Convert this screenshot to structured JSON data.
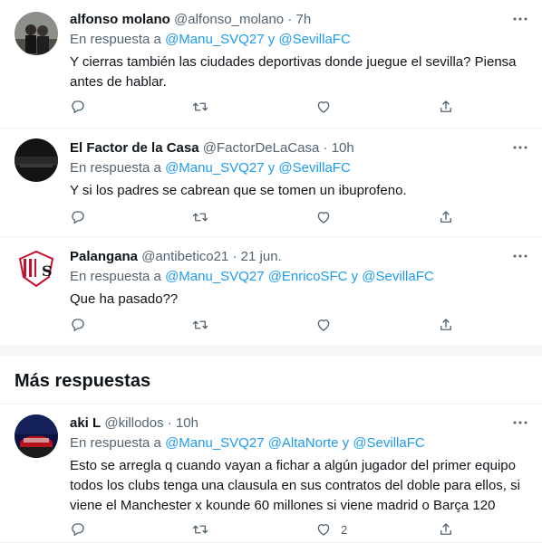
{
  "tweets": [
    {
      "name": "alfonso molano",
      "handle": "@alfonso_molano",
      "time": "· 7h",
      "reply_prefix": "En respuesta a",
      "mentions": [
        "@Manu_SVQ27",
        "@SevillaFC"
      ],
      "connector": "y",
      "text": "Y cierras también las ciudades deportivas donde juegue el sevilla? Piensa antes de hablar."
    },
    {
      "name": "El Factor de la Casa",
      "handle": "@FactorDeLaCasa",
      "time": "· 10h",
      "reply_prefix": "En respuesta a",
      "mentions": [
        "@Manu_SVQ27",
        "@SevillaFC"
      ],
      "connector": "y",
      "text": "Y si los padres se cabrean que se tomen un ibuprofeno."
    },
    {
      "name": "Palangana",
      "handle": "@antibetico21",
      "time": "· 21 jun.",
      "reply_prefix": "En respuesta a",
      "mentions": [
        "@Manu_SVQ27",
        "@EnricoSFC",
        "@SevillaFC"
      ],
      "connector": "y",
      "text": "Que ha pasado??"
    }
  ],
  "section_title": "Más respuestas",
  "more_tweet": {
    "name": "aki L",
    "handle": "@killodos",
    "time": "· 10h",
    "reply_prefix": "En respuesta a",
    "mentions": [
      "@Manu_SVQ27",
      "@AltaNorte",
      "@SevillaFC"
    ],
    "connector": "y",
    "text": "Esto se arregla q cuando vayan a fichar a algún jugador del primer equipo todos los clubs tenga una clausula en sus contratos del doble para ellos, si viene el Manchester x kounde 60 millones si viene madrid o Barça 120",
    "like_count": "2"
  },
  "icons": {
    "reply": "reply-icon",
    "retweet": "retweet-icon",
    "like": "like-icon",
    "share": "share-icon",
    "more": "more-icon"
  },
  "colors": {
    "link": "#1d9bf0",
    "secondary_text": "#536471",
    "primary_text": "#0f1419"
  }
}
